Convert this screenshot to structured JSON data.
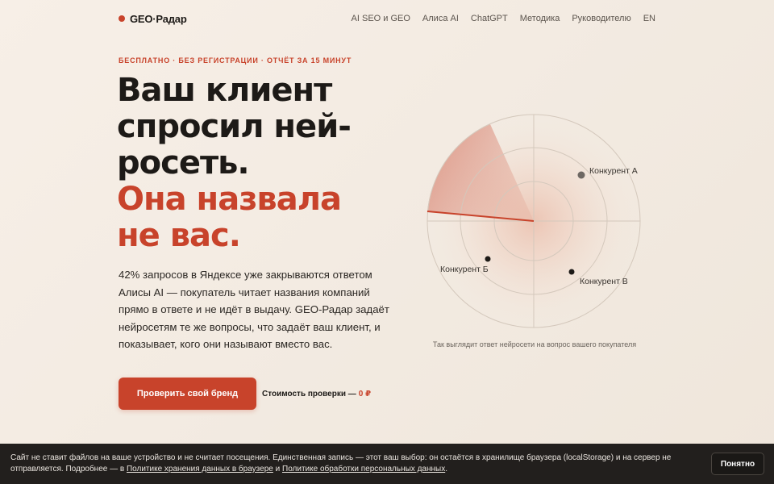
{
  "header": {
    "logo": "GEO·Радар",
    "nav": [
      "AI SEO и GEO",
      "Алиса AI",
      "ChatGPT",
      "Методика",
      "Руководителю",
      "EN"
    ]
  },
  "hero": {
    "eyebrow": "БЕСПЛАТНО · БЕЗ РЕГИСТРАЦИИ · ОТЧЁТ ЗА 15 МИНУТ",
    "headline_lines": [
      "Ваш клиент",
      "спросил ней-",
      "росеть."
    ],
    "headline_accent_lines": [
      "Она назвала",
      "не вас."
    ],
    "lead": "42% запросов в Яндексе уже закрываются ответом Алисы AI — покупатель читает названия компаний прямо в ответе и не идёт в выдачу. GEO-Радар задаёт нейросетям те же вопросы, что задаёт ваш клиент, и показывает, кого они называют вместо вас.",
    "cta_label": "Проверить свой бренд",
    "price_label": "Стоимость проверки —",
    "price_value": "0 ₽"
  },
  "radar": {
    "competitors": [
      {
        "name": "Конкурент А",
        "color": "#6e6863"
      },
      {
        "name": "Конкурент Б",
        "color": "#1d1a17"
      },
      {
        "name": "Конкурент В",
        "color": "#1d1a17"
      }
    ],
    "caption": "Так выглядит ответ нейросети на вопрос вашего покупателя",
    "accent_color": "#c8432b"
  },
  "cookie": {
    "text_before": "Сайт не ставит файлов на ваше устройство и не считает посещения. Единственная запись — этот ваш выбор: он остаётся в хранилище браузера (localStorage) и на сервер не отправляется. Подробнее — в ",
    "link1": "Политике хранения данных в браузере",
    "text_middle": " и ",
    "link2": "Политике обработки персональных данных",
    "text_after": ".",
    "button": "Понятно"
  }
}
